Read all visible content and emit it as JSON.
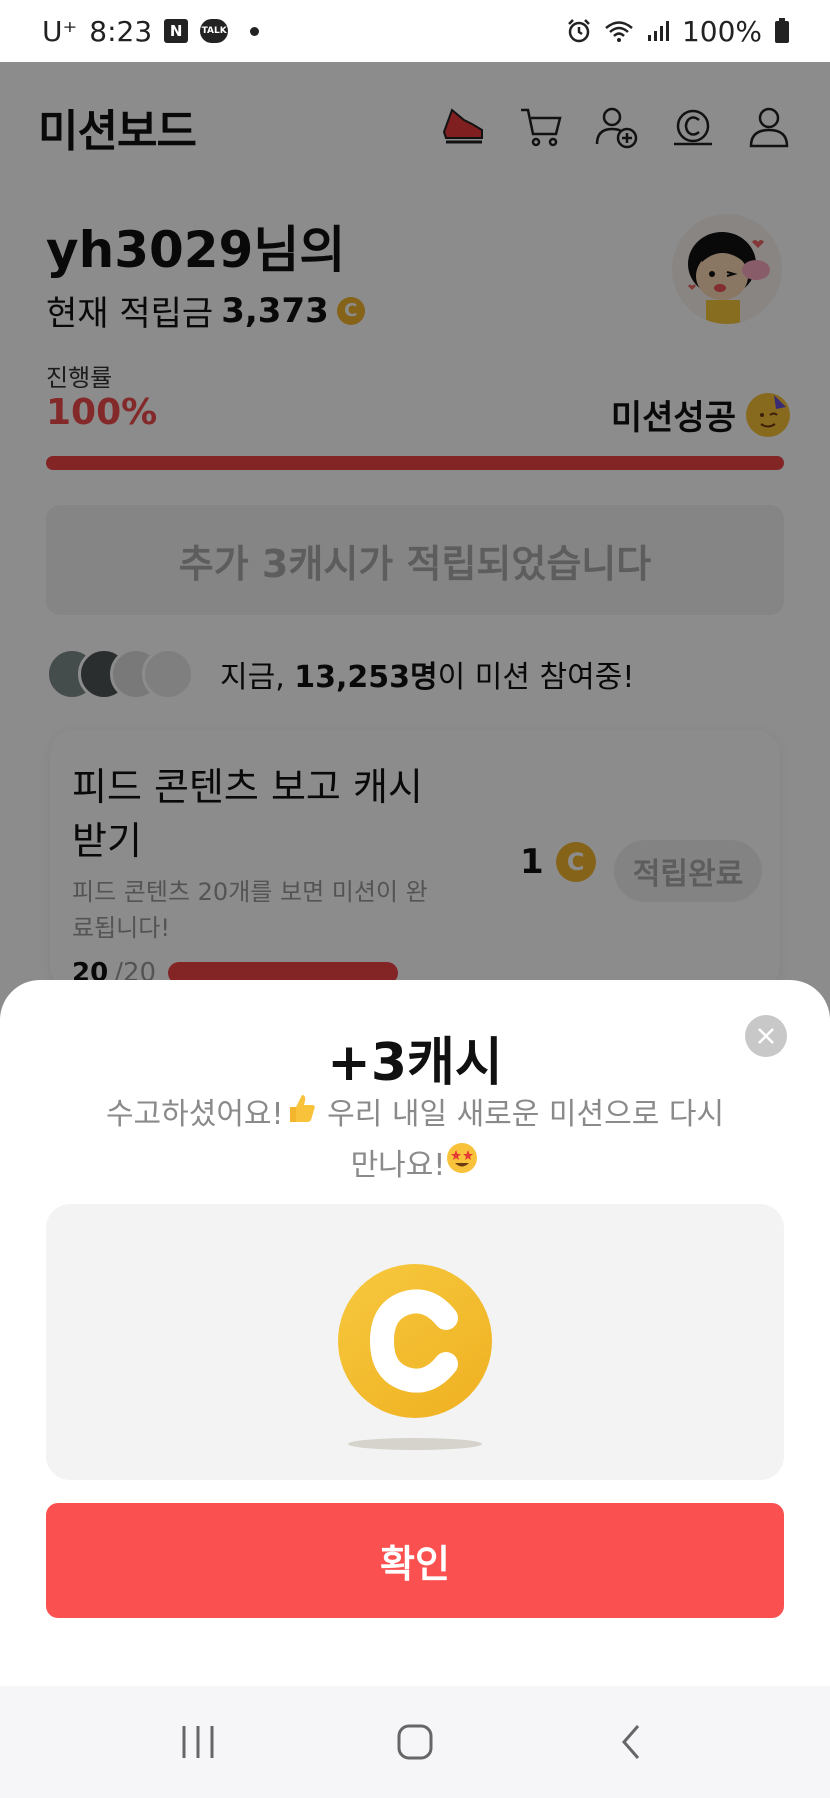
{
  "status_bar": {
    "carrier": "U⁺",
    "time": "8:23",
    "naver_glyph": "N",
    "talk_glyph": "TALK",
    "battery": "100%"
  },
  "header": {
    "title": "미션보드"
  },
  "profile": {
    "username": "yh3029님의",
    "balance_label": "현재 적립금",
    "balance": "3,373",
    "coin_glyph": "C"
  },
  "progress": {
    "label": "진행률",
    "percent": "100%",
    "fraction": 1.0,
    "status": "미션성공"
  },
  "bonus_notice": "추가 3캐시가 적립되었습니다",
  "participants": {
    "prefix": "지금, ",
    "count": "13,253명",
    "suffix": "이 미션 참여중!"
  },
  "mission": {
    "title": "피드 콘텐츠 보고 캐시 받기",
    "description": "피드 콘텐츠 20개를 보면 미션이 완료됩니다!",
    "done": "20",
    "total": "/20",
    "reward": "1",
    "button": "적립완료"
  },
  "dialog": {
    "title": "+3캐시",
    "message_part1": "수고하셨어요!",
    "message_part2": " 우리 내일 새로운 미션으로 다시 만나요!",
    "confirm": "확인"
  },
  "colors": {
    "accent": "#fb5050",
    "progress": "#ee4444",
    "coin": "#f2b52d"
  }
}
